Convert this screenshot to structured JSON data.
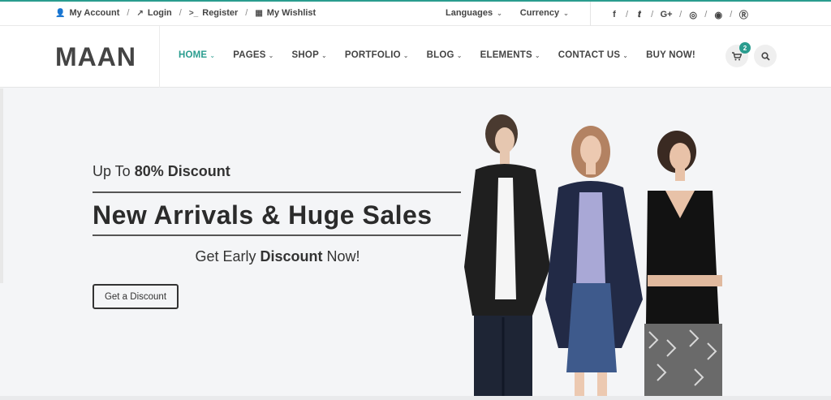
{
  "topbar": {
    "links": [
      {
        "icon": "user-icon",
        "label": "My Account"
      },
      {
        "icon": "external-link-icon",
        "label": "Login"
      },
      {
        "icon": "terminal-icon",
        "label": "Register"
      },
      {
        "icon": "gift-icon",
        "label": "My Wishlist"
      }
    ],
    "languages_label": "Languages",
    "currency_label": "Currency",
    "social": [
      "facebook-icon",
      "twitter-icon",
      "google-plus-icon",
      "dribbble-icon",
      "reddit-icon",
      "skype-icon"
    ]
  },
  "header": {
    "logo": "MAAN",
    "nav": [
      {
        "label": "HOME",
        "active": true
      },
      {
        "label": "PAGES"
      },
      {
        "label": "SHOP"
      },
      {
        "label": "PORTFOLIO"
      },
      {
        "label": "BLOG"
      },
      {
        "label": "ELEMENTS"
      },
      {
        "label": "CONTACT US"
      },
      {
        "label": "BUY NOW!"
      }
    ],
    "cart_count": "2"
  },
  "hero": {
    "discount_prefix": "Up To ",
    "discount_value": "80% Discount",
    "headline": "New Arrivals & Huge Sales",
    "sub_prefix": "Get Early ",
    "sub_bold": "Discount",
    "sub_suffix": " Now!",
    "cta_label": "Get a Discount"
  },
  "colors": {
    "accent": "#2a9d8f",
    "text": "#333333",
    "hero_bg": "#f4f5f7"
  }
}
